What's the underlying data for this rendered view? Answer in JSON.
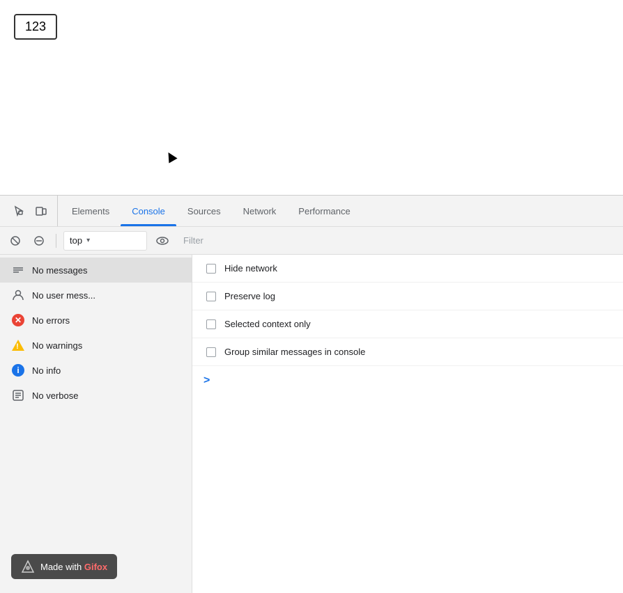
{
  "page": {
    "number_box": "123"
  },
  "devtools": {
    "tabs": [
      {
        "id": "elements",
        "label": "Elements",
        "active": false
      },
      {
        "id": "console",
        "label": "Console",
        "active": true
      },
      {
        "id": "sources",
        "label": "Sources",
        "active": false
      },
      {
        "id": "network",
        "label": "Network",
        "active": false
      },
      {
        "id": "performance",
        "label": "Performance",
        "active": false
      }
    ],
    "toolbar": {
      "context_value": "top",
      "context_placeholder": "top",
      "filter_placeholder": "Filter"
    },
    "filter_items": [
      {
        "id": "messages",
        "icon_type": "messages",
        "label": "No messages"
      },
      {
        "id": "user",
        "icon_type": "user",
        "label": "No user mess..."
      },
      {
        "id": "errors",
        "icon_type": "error",
        "label": "No errors"
      },
      {
        "id": "warnings",
        "icon_type": "warning",
        "label": "No warnings"
      },
      {
        "id": "info",
        "icon_type": "info",
        "label": "No info"
      },
      {
        "id": "verbose",
        "icon_type": "verbose",
        "label": "No verbose"
      }
    ],
    "options": [
      {
        "id": "hide-network",
        "label": "Hide network",
        "checked": false
      },
      {
        "id": "preserve-log",
        "label": "Preserve log",
        "checked": false
      },
      {
        "id": "selected-context",
        "label": "Selected context only",
        "checked": false
      },
      {
        "id": "group-similar",
        "label": "Group similar messages in console",
        "checked": false
      }
    ],
    "console_prompt": ">",
    "gifox_badge": {
      "made_with": "Made with ",
      "brand": "Gifox"
    }
  }
}
